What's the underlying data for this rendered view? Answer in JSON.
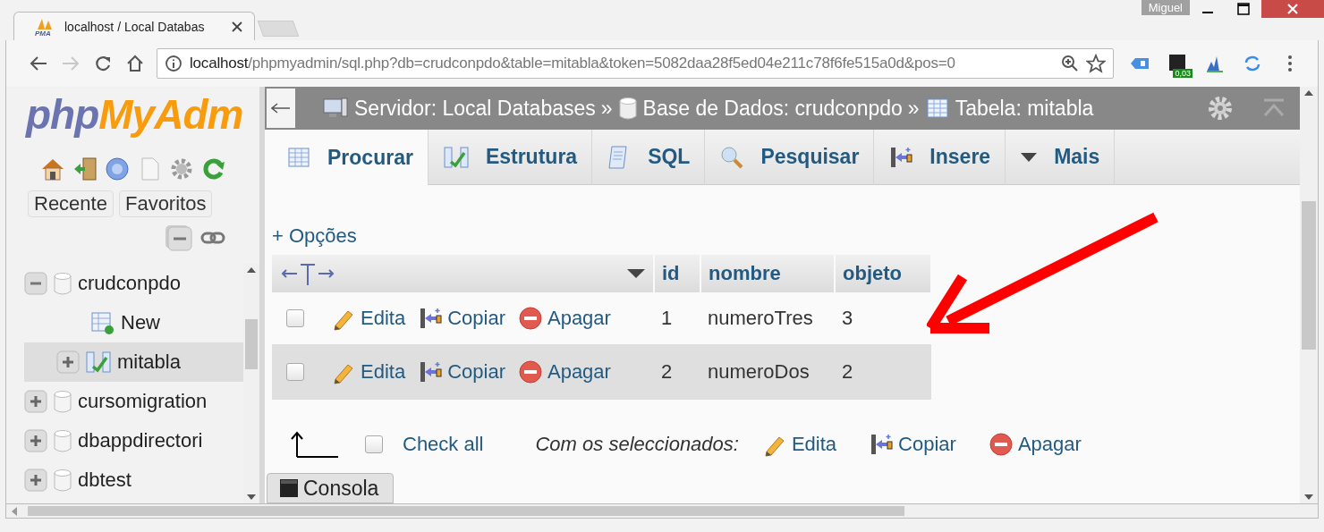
{
  "browser": {
    "tab": {
      "favicon_label": "PMA",
      "title": "localhost / Local Databas"
    },
    "profile": "Miguel",
    "nav": {
      "forward_disabled": true
    },
    "address": {
      "host": "localhost",
      "path": "/phpmyadmin/sql.php?db=crudconpdo&table=mitabla&token=5082daa28f5ed04e211c78f6fe515a0d&pos=0"
    },
    "extension_badge": "0,03"
  },
  "sidebar": {
    "logo": {
      "first": "php",
      "second": "MyAdm"
    },
    "buttons": [
      "Recente",
      "Favoritos"
    ],
    "tree": [
      {
        "label": "crudconpdo",
        "expanded": true,
        "selected": false,
        "children": [
          {
            "label": "New",
            "kind": "new",
            "selected": false
          },
          {
            "label": "mitabla",
            "kind": "table",
            "expanded": false,
            "selected": true
          }
        ]
      },
      {
        "label": "cursomigration",
        "expanded": false,
        "selected": false
      },
      {
        "label": "dbappdirectori",
        "expanded": false,
        "selected": false
      },
      {
        "label": "dbtest",
        "expanded": false,
        "selected": false
      }
    ]
  },
  "breadcrumb": [
    {
      "kind": "server",
      "label": "Servidor: Local Databases",
      "separator": "»"
    },
    {
      "kind": "database",
      "label": "Base de Dados: crudconpdo",
      "separator": "»"
    },
    {
      "kind": "table",
      "label": "Tabela: mitabla"
    }
  ],
  "tabs": [
    {
      "kind": "browse",
      "label": "Procurar",
      "selected": true
    },
    {
      "kind": "structure",
      "label": "Estrutura",
      "selected": false
    },
    {
      "kind": "sql",
      "label": "SQL",
      "selected": false
    },
    {
      "kind": "search",
      "label": "Pesquisar",
      "selected": false
    },
    {
      "kind": "insert",
      "label": "Insere",
      "selected": false
    },
    {
      "kind": "more",
      "label": "Mais",
      "selected": false
    }
  ],
  "options_link": "+ Opções",
  "table": {
    "columns": [
      "id",
      "nombre",
      "objeto"
    ],
    "rows": [
      {
        "checked": false,
        "actions": [
          {
            "kind": "edit",
            "label": "Edita"
          },
          {
            "kind": "copy",
            "label": "Copiar"
          },
          {
            "kind": "delete",
            "label": "Apagar"
          }
        ],
        "cells": [
          "1",
          "numeroTres",
          "3"
        ]
      },
      {
        "checked": false,
        "actions": [
          {
            "kind": "edit",
            "label": "Edita"
          },
          {
            "kind": "copy",
            "label": "Copiar"
          },
          {
            "kind": "delete",
            "label": "Apagar"
          }
        ],
        "cells": [
          "2",
          "numeroDos",
          "2"
        ]
      }
    ]
  },
  "footer": {
    "check_all": {
      "label": "Check all",
      "checked": false
    },
    "with_selected": "Com os seleccionados:",
    "actions": [
      {
        "kind": "edit",
        "label": "Edita"
      },
      {
        "kind": "copy",
        "label": "Copiar"
      },
      {
        "kind": "delete",
        "label": "Apagar"
      }
    ]
  },
  "console": "Consola"
}
